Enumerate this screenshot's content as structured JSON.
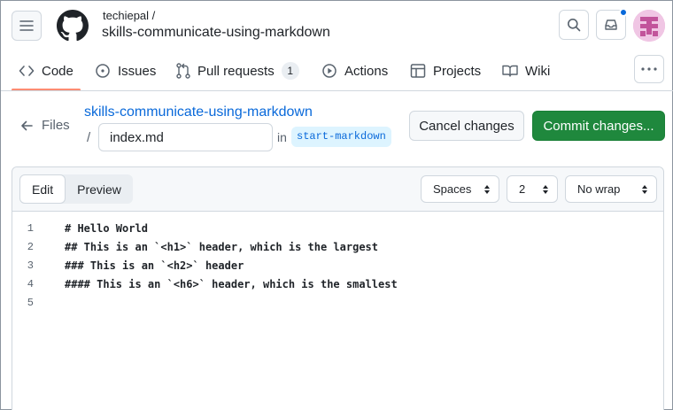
{
  "header": {
    "owner": "techiepal /",
    "repo": "skills-communicate-using-markdown"
  },
  "nav": {
    "tabs": [
      {
        "label": "Code",
        "icon": "code-icon"
      },
      {
        "label": "Issues",
        "icon": "issue-icon"
      },
      {
        "label": "Pull requests",
        "icon": "pull-request-icon",
        "count": "1"
      },
      {
        "label": "Actions",
        "icon": "play-icon"
      },
      {
        "label": "Projects",
        "icon": "table-icon"
      },
      {
        "label": "Wiki",
        "icon": "book-icon"
      }
    ],
    "active": "Code"
  },
  "path": {
    "back_label": "Files",
    "repo_link": "skills-communicate-using-markdown",
    "separator": "/",
    "filename": "index.md",
    "in_label": "in",
    "branch": "start-markdown"
  },
  "actions": {
    "cancel": "Cancel changes",
    "commit": "Commit changes..."
  },
  "editor": {
    "tabs": {
      "edit": "Edit",
      "preview": "Preview"
    },
    "indent_mode": "Spaces",
    "indent_size": "2",
    "wrap_mode": "No wrap",
    "lines": [
      {
        "n": "1",
        "text": "# Hello World"
      },
      {
        "n": "2",
        "text": "## This is an `<h1>` header, which is the largest"
      },
      {
        "n": "3",
        "text": "### This is an `<h2>` header"
      },
      {
        "n": "4",
        "text": "#### This is an `<h6>` header, which is the smallest"
      },
      {
        "n": "5",
        "text": ""
      }
    ]
  },
  "colors": {
    "accent_link": "#0969da",
    "commit_green": "#1f883d",
    "tab_underline": "#fd8c73",
    "notification_dot": "#0969da"
  }
}
